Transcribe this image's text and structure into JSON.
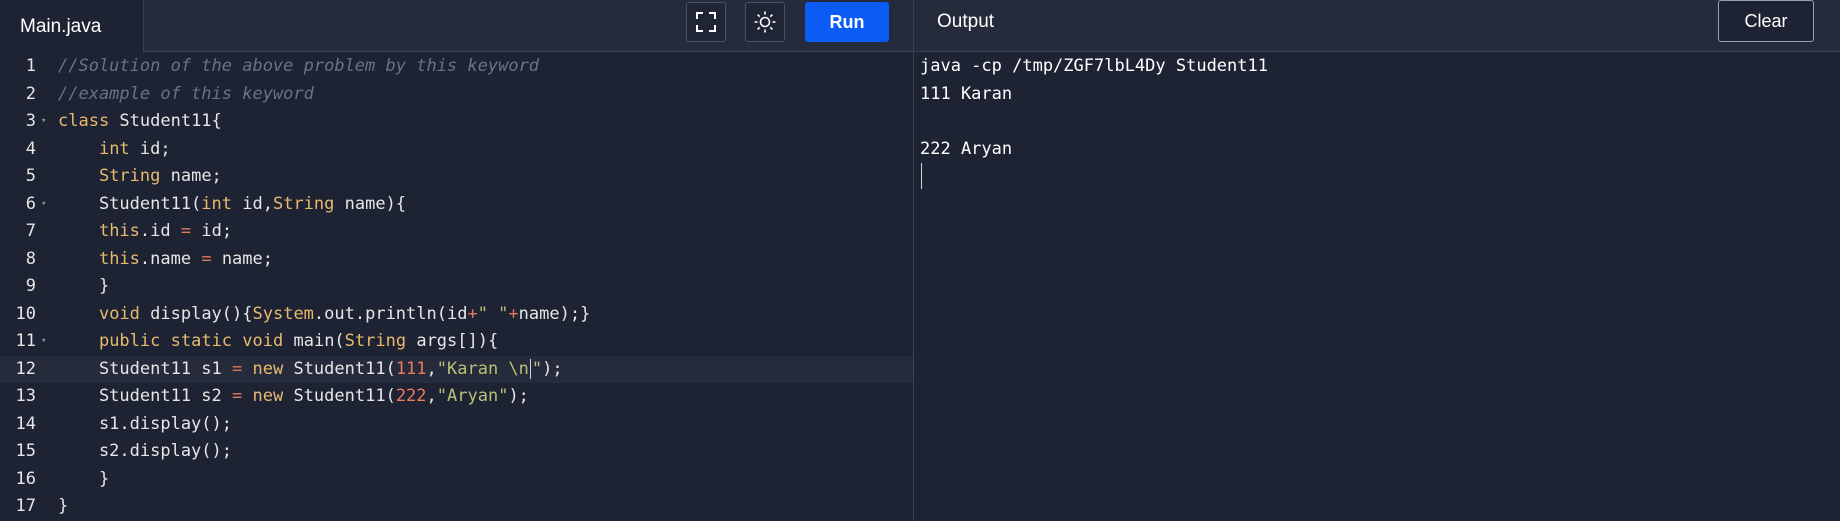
{
  "tab": {
    "filename": "Main.java"
  },
  "toolbar": {
    "run_label": "Run",
    "fullscreen_icon": "fullscreen-icon",
    "theme_icon": "sun-icon"
  },
  "output_panel": {
    "title": "Output",
    "clear_label": "Clear",
    "lines": [
      "java -cp /tmp/ZGF7lbL4Dy Student11",
      "111 Karan",
      "",
      "222 Aryan"
    ]
  },
  "editor": {
    "line_numbers": [
      "1",
      "2",
      "3",
      "4",
      "5",
      "6",
      "7",
      "8",
      "9",
      "10",
      "11",
      "12",
      "13",
      "14",
      "15",
      "16",
      "17"
    ],
    "lines": [
      [
        {
          "t": "//Solution of the above problem by this keyword",
          "c": "com"
        }
      ],
      [
        {
          "t": "//example of this keyword",
          "c": "com"
        }
      ],
      [
        {
          "t": "class",
          "c": "kw"
        },
        {
          "t": " Student11{",
          "c": "txt"
        }
      ],
      [
        {
          "t": "    ",
          "c": "txt"
        },
        {
          "t": "int",
          "c": "kw"
        },
        {
          "t": " id;",
          "c": "txt"
        }
      ],
      [
        {
          "t": "    ",
          "c": "txt"
        },
        {
          "t": "String",
          "c": "kw"
        },
        {
          "t": " name;",
          "c": "txt"
        }
      ],
      [
        {
          "t": "    Student11(",
          "c": "txt"
        },
        {
          "t": "int",
          "c": "kw"
        },
        {
          "t": " id,",
          "c": "txt"
        },
        {
          "t": "String",
          "c": "kw"
        },
        {
          "t": " name){",
          "c": "txt"
        }
      ],
      [
        {
          "t": "    ",
          "c": "txt"
        },
        {
          "t": "this",
          "c": "kw"
        },
        {
          "t": ".id ",
          "c": "txt"
        },
        {
          "t": "=",
          "c": "op"
        },
        {
          "t": " id;",
          "c": "txt"
        }
      ],
      [
        {
          "t": "    ",
          "c": "txt"
        },
        {
          "t": "this",
          "c": "kw"
        },
        {
          "t": ".name ",
          "c": "txt"
        },
        {
          "t": "=",
          "c": "op"
        },
        {
          "t": " name;",
          "c": "txt"
        }
      ],
      [
        {
          "t": "    }",
          "c": "txt"
        }
      ],
      [
        {
          "t": "    ",
          "c": "txt"
        },
        {
          "t": "void",
          "c": "kw"
        },
        {
          "t": " display(){",
          "c": "txt"
        },
        {
          "t": "System",
          "c": "kw"
        },
        {
          "t": ".out.println(id",
          "c": "txt"
        },
        {
          "t": "+",
          "c": "op"
        },
        {
          "t": "\" \"",
          "c": "str"
        },
        {
          "t": "+",
          "c": "op"
        },
        {
          "t": "name);}",
          "c": "txt"
        }
      ],
      [
        {
          "t": "    ",
          "c": "txt"
        },
        {
          "t": "public",
          "c": "kw"
        },
        {
          "t": " ",
          "c": "txt"
        },
        {
          "t": "static",
          "c": "kw"
        },
        {
          "t": " ",
          "c": "txt"
        },
        {
          "t": "void",
          "c": "kw"
        },
        {
          "t": " main(",
          "c": "txt"
        },
        {
          "t": "String",
          "c": "kw"
        },
        {
          "t": " args[]){",
          "c": "txt"
        }
      ],
      [
        {
          "t": "    Student11 s1 ",
          "c": "txt"
        },
        {
          "t": "=",
          "c": "op"
        },
        {
          "t": " ",
          "c": "txt"
        },
        {
          "t": "new",
          "c": "kw"
        },
        {
          "t": " Student11(",
          "c": "txt"
        },
        {
          "t": "111",
          "c": "num"
        },
        {
          "t": ",",
          "c": "txt"
        },
        {
          "t": "\"Karan \\n",
          "c": "str"
        },
        {
          "t": "CURSOR",
          "c": "cursor"
        },
        {
          "t": "\"",
          "c": "str"
        },
        {
          "t": ");",
          "c": "txt"
        }
      ],
      [
        {
          "t": "    Student11 s2 ",
          "c": "txt"
        },
        {
          "t": "=",
          "c": "op"
        },
        {
          "t": " ",
          "c": "txt"
        },
        {
          "t": "new",
          "c": "kw"
        },
        {
          "t": " Student11(",
          "c": "txt"
        },
        {
          "t": "222",
          "c": "num"
        },
        {
          "t": ",",
          "c": "txt"
        },
        {
          "t": "\"Aryan\"",
          "c": "str"
        },
        {
          "t": ");",
          "c": "txt"
        }
      ],
      [
        {
          "t": "    s1.display();",
          "c": "txt"
        }
      ],
      [
        {
          "t": "    s2.display();",
          "c": "txt"
        }
      ],
      [
        {
          "t": "    }",
          "c": "txt"
        }
      ],
      [
        {
          "t": "}",
          "c": "txt"
        }
      ]
    ],
    "fold_markers": [
      "3",
      "6",
      "11"
    ]
  }
}
